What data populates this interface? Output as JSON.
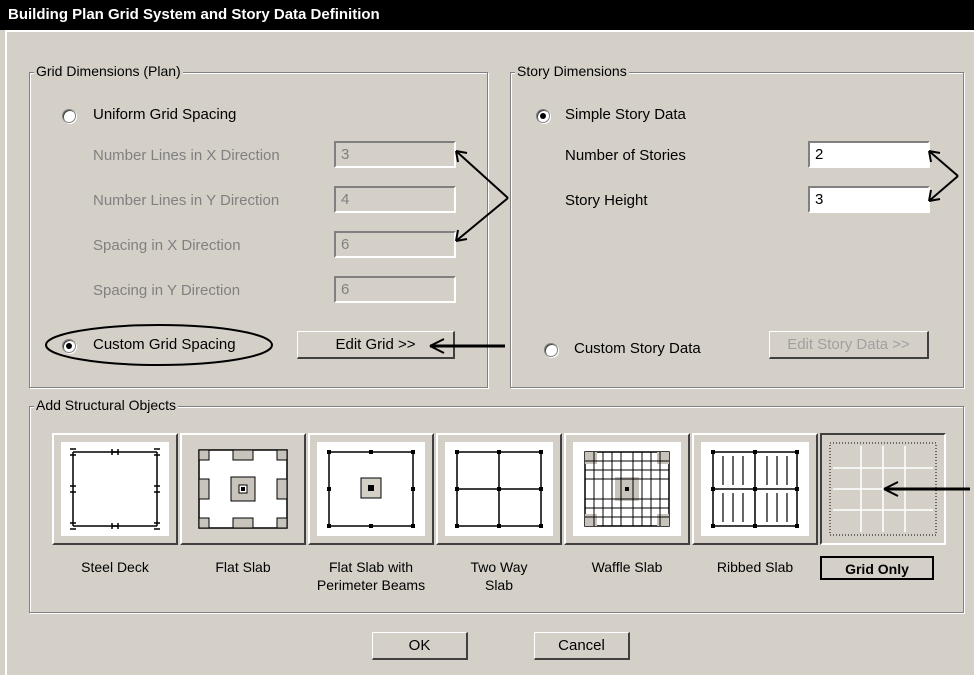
{
  "window": {
    "title": "Building Plan Grid System and Story Data Definition"
  },
  "grid_dimensions": {
    "group_label": "Grid Dimensions (Plan)",
    "uniform_label": "Uniform Grid Spacing",
    "uniform_selected": false,
    "fields": [
      {
        "label": "Number Lines in X Direction",
        "value": "3"
      },
      {
        "label": "Number Lines in Y Direction",
        "value": "4"
      },
      {
        "label": "Spacing in X Direction",
        "value": "6"
      },
      {
        "label": "Spacing in Y Direction",
        "value": "6"
      }
    ],
    "custom_label": "Custom Grid Spacing",
    "custom_selected": true,
    "edit_grid_label": "Edit Grid >>"
  },
  "story_dimensions": {
    "group_label": "Story Dimensions",
    "simple_label": "Simple Story Data",
    "simple_selected": true,
    "fields": [
      {
        "label": "Number of Stories",
        "value": "2"
      },
      {
        "label": "Story Height",
        "value": "3"
      }
    ],
    "custom_label": "Custom Story Data",
    "custom_selected": false,
    "edit_story_label": "Edit Story Data >>"
  },
  "structural_objects": {
    "group_label": "Add Structural Objects",
    "items": [
      {
        "label": "Steel Deck",
        "icon": "steel-deck-icon"
      },
      {
        "label": "Flat Slab",
        "icon": "flat-slab-icon"
      },
      {
        "label": "Flat Slab with Perimeter Beams",
        "icon": "flat-slab-perimeter-beams-icon"
      },
      {
        "label": "Two Way Slab",
        "icon": "two-way-slab-icon"
      },
      {
        "label": "Waffle Slab",
        "icon": "waffle-slab-icon"
      },
      {
        "label": "Ribbed Slab",
        "icon": "ribbed-slab-icon"
      },
      {
        "label": "Grid Only",
        "icon": "grid-only-icon",
        "selected": true
      }
    ]
  },
  "buttons": {
    "ok": "OK",
    "cancel": "Cancel"
  }
}
